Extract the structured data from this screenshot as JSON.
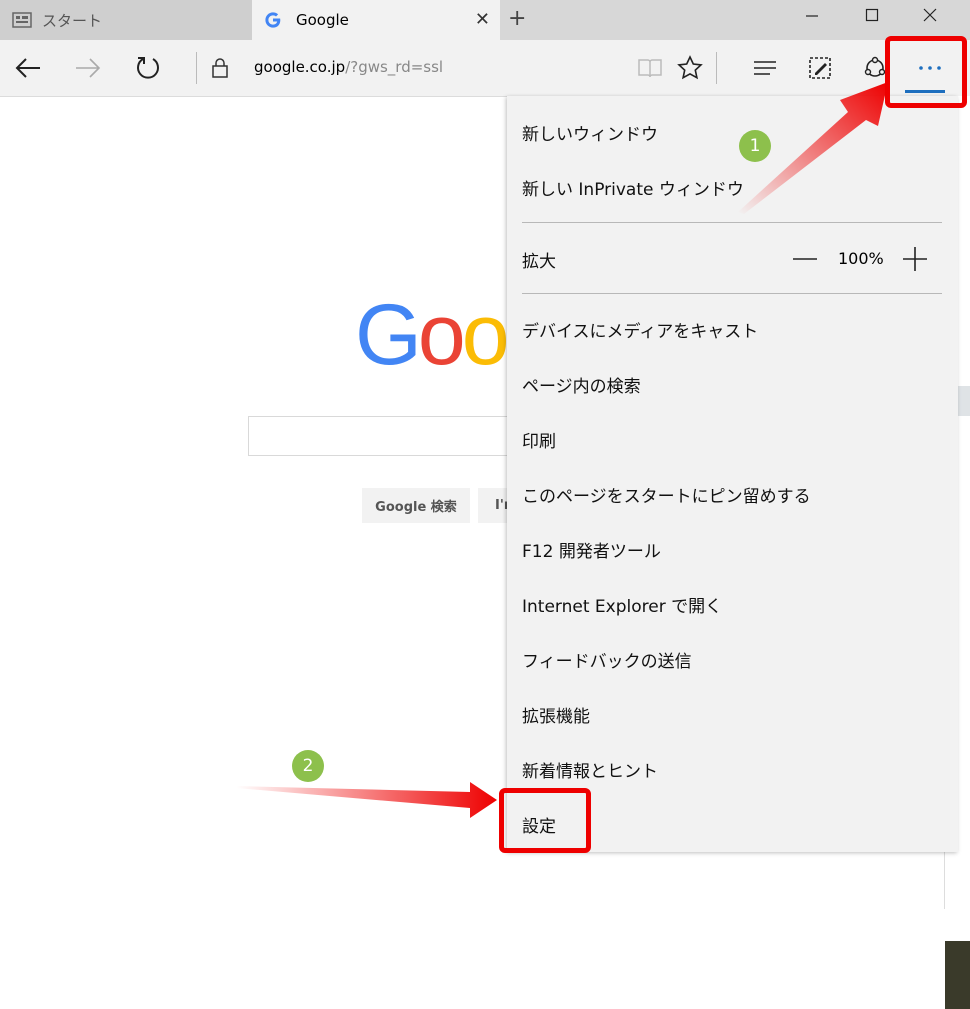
{
  "tabs": [
    {
      "label": "スタート"
    },
    {
      "label": "Google"
    }
  ],
  "address": {
    "host": "google.co.jp",
    "path": "/?gws_rd=ssl"
  },
  "google": {
    "search_button": "Google 検索",
    "lucky_button": "I'm"
  },
  "menu": {
    "new_window": "新しいウィンドウ",
    "new_inprivate": "新しい InPrivate ウィンドウ",
    "zoom_label": "拡大",
    "zoom_value": "100%",
    "cast": "デバイスにメディアをキャスト",
    "find": "ページ内の検索",
    "print": "印刷",
    "pin": "このページをスタートにピン留めする",
    "devtools": "F12 開発者ツール",
    "open_ie": "Internet Explorer で開く",
    "feedback": "フィードバックの送信",
    "extensions": "拡張機能",
    "tips": "新着情報とヒント",
    "settings": "設定"
  },
  "badges": {
    "one": "1",
    "two": "2"
  },
  "colors": {
    "highlight": "#ee0000",
    "badge": "#8dc04c",
    "accent": "#1e6fbf"
  }
}
